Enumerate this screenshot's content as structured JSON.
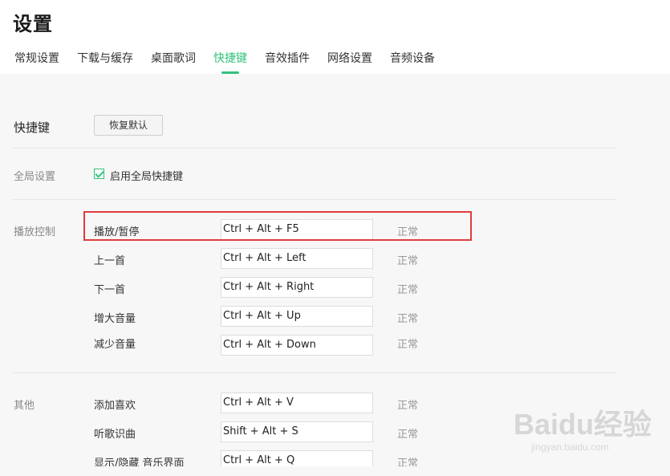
{
  "title": "设置",
  "tabs": [
    {
      "label": "常规设置",
      "active": false
    },
    {
      "label": "下载与缓存",
      "active": false
    },
    {
      "label": "桌面歌词",
      "active": false
    },
    {
      "label": "快捷键",
      "active": true
    },
    {
      "label": "音效插件",
      "active": false
    },
    {
      "label": "网络设置",
      "active": false
    },
    {
      "label": "音频设备",
      "active": false
    }
  ],
  "shortcuts_section": {
    "label": "快捷键",
    "restore_button": "恢复默认"
  },
  "global_section": {
    "label": "全局设置",
    "checkbox_label": "启用全局快捷键",
    "checked": true
  },
  "playback_section": {
    "label": "播放控制",
    "rows": [
      {
        "action": "播放/暂停",
        "keys": "Ctrl + Alt + F5",
        "status": "正常"
      },
      {
        "action": "上一首",
        "keys": "Ctrl + Alt + Left",
        "status": "正常"
      },
      {
        "action": "下一首",
        "keys": "Ctrl + Alt + Right",
        "status": "正常"
      },
      {
        "action": "增大音量",
        "keys": "Ctrl + Alt + Up",
        "status": "正常"
      },
      {
        "action": "减少音量",
        "keys": "Ctrl + Alt + Down",
        "status": "正常"
      }
    ]
  },
  "other_section": {
    "label": "其他",
    "rows": [
      {
        "action": "添加喜欢",
        "keys": "Ctrl + Alt + V",
        "status": "正常"
      },
      {
        "action": "听歌识曲",
        "keys": "Shift + Alt + S",
        "status": "正常"
      },
      {
        "action": "显示/隐藏 音乐界面",
        "keys": "Ctrl + Alt + Q",
        "status": "正常"
      }
    ]
  },
  "colors": {
    "accent": "#31c27c",
    "highlight": "#e03c3c"
  },
  "watermark": {
    "logo": "Baidu经验",
    "sub": "jingyan.baidu.com"
  }
}
